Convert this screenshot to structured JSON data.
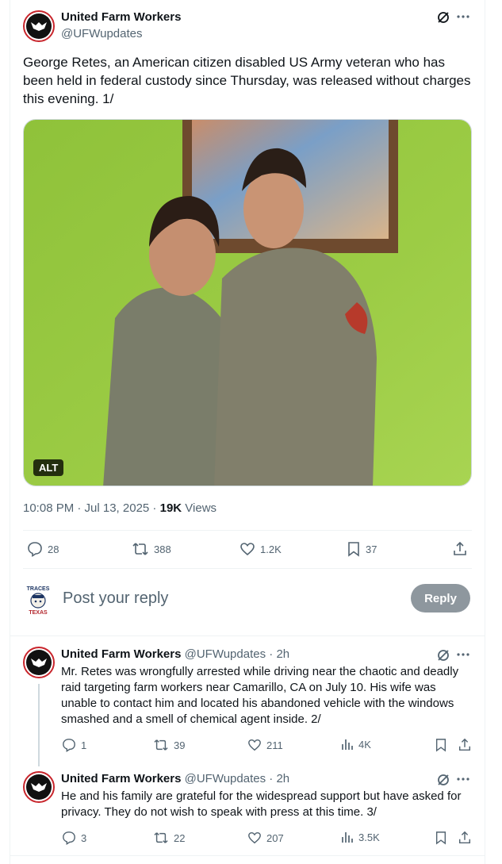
{
  "main_tweet": {
    "author_name": "United Farm Workers",
    "author_handle": "@UFWupdates",
    "text": "George Retes, an American citizen disabled US Army veteran who has been held in federal custody since Thursday, was released without charges this evening. 1/",
    "media_alt_badge": "ALT",
    "timestamp": "10:08 PM · Jul 13, 2025 · ",
    "views_count": "19K",
    "views_label": " Views",
    "stats": {
      "replies": "28",
      "reposts": "388",
      "likes": "1.2K",
      "bookmarks": "37"
    }
  },
  "composer": {
    "placeholder": "Post your reply",
    "reply_button": "Reply"
  },
  "replies": [
    {
      "author_name": "United Farm Workers",
      "author_handle": "@UFWupdates",
      "time": " · 2h",
      "text": "Mr. Retes was wrongfully arrested while driving near the chaotic and deadly raid targeting farm workers near Camarillo, CA on July 10. His wife was unable to contact him and located his abandoned vehicle with the windows smashed and a smell of chemical agent inside. 2/",
      "stats": {
        "replies": "1",
        "reposts": "39",
        "likes": "211",
        "views": "4K"
      }
    },
    {
      "author_name": "United Farm Workers",
      "author_handle": "@UFWupdates",
      "time": " · 2h",
      "text": "He and his family are grateful for the widespread support but have asked for privacy. They do not wish to speak with press at this time. 3/",
      "stats": {
        "replies": "3",
        "reposts": "22",
        "likes": "207",
        "views": "3.5K"
      }
    }
  ],
  "icons": [
    "grok-icon",
    "more-icon",
    "reply-icon",
    "repost-icon",
    "like-icon",
    "bookmark-icon",
    "share-icon",
    "views-icon"
  ],
  "colors": {
    "text": "#0f1419",
    "secondary": "#536471",
    "border": "#eff3f4",
    "reply_button": "#8e979e",
    "avatar_ring": "#c8252c"
  }
}
